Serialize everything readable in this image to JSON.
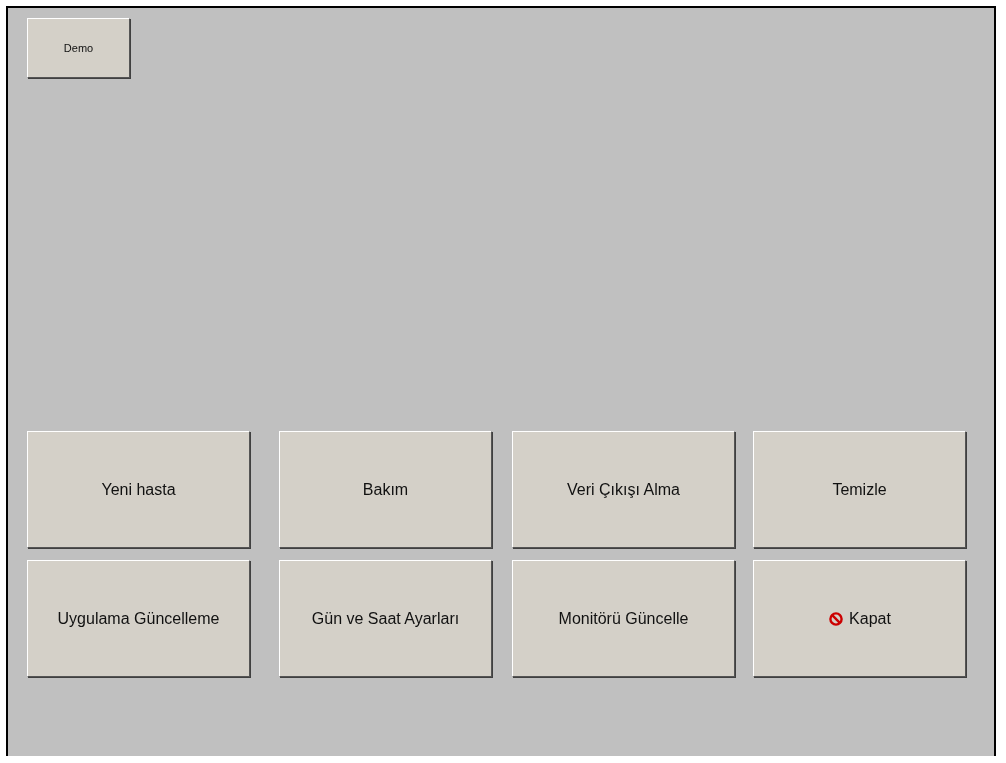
{
  "top_button": {
    "label": "Demo"
  },
  "buttons": [
    {
      "label": "Yeni hasta",
      "kind": "plain"
    },
    {
      "label": "Bakım",
      "kind": "plain"
    },
    {
      "label": "Veri Çıkışı Alma",
      "kind": "plain"
    },
    {
      "label": "Temizle",
      "kind": "plain"
    },
    {
      "label": "Uygulama Güncelleme",
      "kind": "plain"
    },
    {
      "label": "Gün ve Saat Ayarları",
      "kind": "plain"
    },
    {
      "label": "Monitörü Güncelle",
      "kind": "plain"
    },
    {
      "label": "Kapat",
      "kind": "prohibit"
    }
  ]
}
